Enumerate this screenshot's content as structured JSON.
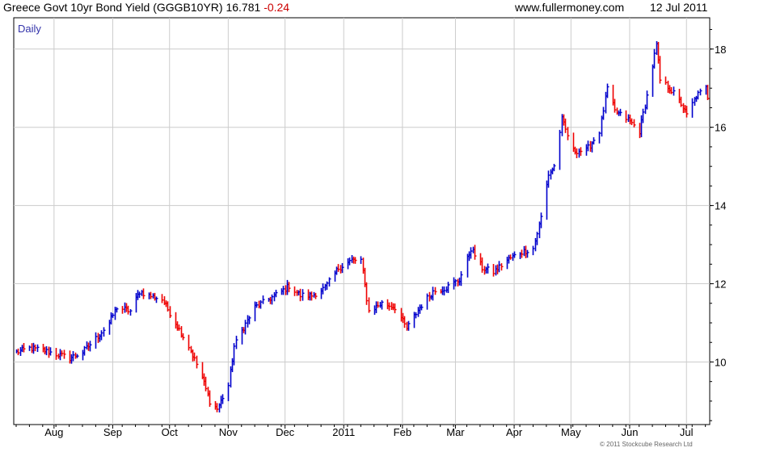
{
  "header": {
    "title": "Greece Govt 10yr Bond Yield (GGGB10YR)",
    "last": "16.781",
    "change": "-0.24",
    "site": "www.fullermoney.com",
    "date": "12 Jul 2011"
  },
  "footer": "© 2011 Stockcube Research Ltd",
  "chart_data": {
    "type": "line",
    "frequency_label": "Daily",
    "style": "high-low bars, blue = up day, red = down day",
    "x_ticks": [
      "Aug",
      "Sep",
      "Oct",
      "Nov",
      "Dec",
      "2011",
      "Feb",
      "Mar",
      "Apr",
      "May",
      "Jun",
      "Jul"
    ],
    "y_ticks": [
      10,
      12,
      14,
      16,
      18
    ],
    "ylim": [
      8.4,
      18.8
    ],
    "x_range": [
      "2010-07-12",
      "2011-07-12"
    ],
    "grid": true,
    "y_axis_side": "right",
    "colors": {
      "up": "#0000cc",
      "down": "#ee0000",
      "grid": "#cccccc",
      "label": "#3333aa"
    },
    "series": [
      {
        "points": [
          [
            "2010-07-12",
            10.25
          ],
          [
            "2010-07-19",
            10.35
          ],
          [
            "2010-07-26",
            10.3
          ],
          [
            "2010-08-02",
            10.2
          ],
          [
            "2010-08-09",
            10.1
          ],
          [
            "2010-08-16",
            10.25
          ],
          [
            "2010-08-23",
            10.6
          ],
          [
            "2010-08-30",
            11.0
          ],
          [
            "2010-09-03",
            11.4
          ],
          [
            "2010-09-10",
            11.3
          ],
          [
            "2010-09-15",
            11.8
          ],
          [
            "2010-09-20",
            11.7
          ],
          [
            "2010-09-27",
            11.6
          ],
          [
            "2010-10-04",
            11.0
          ],
          [
            "2010-10-11",
            10.4
          ],
          [
            "2010-10-18",
            9.6
          ],
          [
            "2010-10-22",
            9.0
          ],
          [
            "2010-10-26",
            8.8
          ],
          [
            "2010-11-01",
            9.4
          ],
          [
            "2010-11-04",
            10.4
          ],
          [
            "2010-11-08",
            10.8
          ],
          [
            "2010-11-15",
            11.4
          ],
          [
            "2010-11-22",
            11.6
          ],
          [
            "2010-11-29",
            11.8
          ],
          [
            "2010-12-03",
            11.95
          ],
          [
            "2010-12-09",
            11.7
          ],
          [
            "2010-12-15",
            11.7
          ],
          [
            "2010-12-22",
            11.9
          ],
          [
            "2010-12-29",
            12.4
          ],
          [
            "2011-01-05",
            12.6
          ],
          [
            "2011-01-10",
            12.6
          ],
          [
            "2011-01-14",
            11.3
          ],
          [
            "2011-01-21",
            11.5
          ],
          [
            "2011-01-28",
            11.4
          ],
          [
            "2011-02-03",
            10.85
          ],
          [
            "2011-02-10",
            11.4
          ],
          [
            "2011-02-17",
            11.8
          ],
          [
            "2011-02-24",
            11.9
          ],
          [
            "2011-03-03",
            12.1
          ],
          [
            "2011-03-09",
            12.9
          ],
          [
            "2011-03-15",
            12.4
          ],
          [
            "2011-03-21",
            12.3
          ],
          [
            "2011-03-28",
            12.6
          ],
          [
            "2011-04-04",
            12.8
          ],
          [
            "2011-04-11",
            12.9
          ],
          [
            "2011-04-15",
            13.7
          ],
          [
            "2011-04-19",
            14.8
          ],
          [
            "2011-04-22",
            15.0
          ],
          [
            "2011-04-26",
            16.2
          ],
          [
            "2011-05-02",
            15.4
          ],
          [
            "2011-05-09",
            15.4
          ],
          [
            "2011-05-16",
            15.9
          ],
          [
            "2011-05-20",
            17.0
          ],
          [
            "2011-05-24",
            16.4
          ],
          [
            "2011-05-31",
            16.2
          ],
          [
            "2011-06-06",
            15.9
          ],
          [
            "2011-06-10",
            16.8
          ],
          [
            "2011-06-15",
            18.1
          ],
          [
            "2011-06-17",
            17.2
          ],
          [
            "2011-06-22",
            17.0
          ],
          [
            "2011-06-28",
            16.6
          ],
          [
            "2011-07-01",
            16.3
          ],
          [
            "2011-07-06",
            16.8
          ],
          [
            "2011-07-11",
            17.0
          ],
          [
            "2011-07-12",
            16.78
          ]
        ]
      }
    ]
  }
}
